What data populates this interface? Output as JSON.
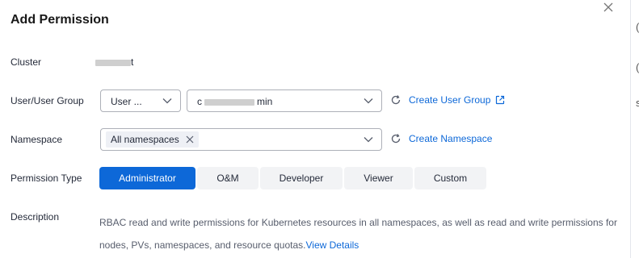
{
  "dialog": {
    "title": "Add Permission",
    "close_icon": "close-icon"
  },
  "cluster": {
    "label": "Cluster",
    "value_prefix": "",
    "value_suffix": "t"
  },
  "user_group": {
    "label": "User/User Group",
    "type_select": "User ...",
    "user_prefix": "c",
    "user_suffix": "min",
    "create_link": "Create User Group"
  },
  "namespace": {
    "label": "Namespace",
    "tag": "All namespaces",
    "create_link": "Create Namespace"
  },
  "permission": {
    "label": "Permission Type",
    "options": [
      "Administrator",
      "O&M",
      "Developer",
      "Viewer",
      "Custom"
    ],
    "selected": "Administrator"
  },
  "description": {
    "label": "Description",
    "text": "RBAC read and write permissions for Kubernetes resources in all namespaces, as well as read and write permissions for nodes, PVs, namespaces, and resource quotas.",
    "link": "View Details"
  },
  "colors": {
    "accent": "#0d68d8",
    "border": "#adb0b8",
    "segment_bg": "#f2f3f5"
  }
}
